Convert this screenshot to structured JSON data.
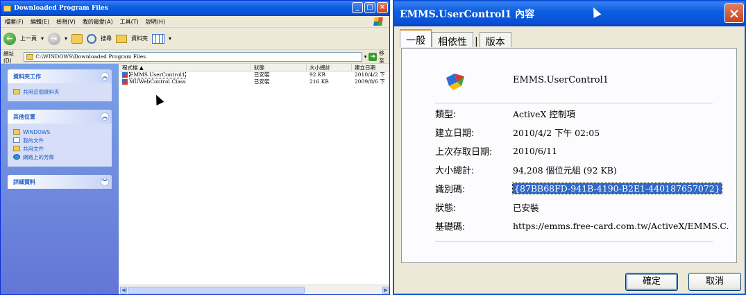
{
  "explorer": {
    "title": "Downloaded Program Files",
    "menu": [
      "檔案(F)",
      "編輯(E)",
      "檢視(V)",
      "我的最愛(A)",
      "工具(T)",
      "說明(H)"
    ],
    "toolbar": {
      "back": "上一頁",
      "search": "搜尋",
      "folders": "資料夾"
    },
    "address": {
      "label": "網址(D)",
      "path": "C:\\WINDOWS\\Downloaded Program Files",
      "go": "移至"
    },
    "taskpane": [
      {
        "title": "資料夾工作",
        "items": [
          {
            "label": "共用這個資料夾",
            "icon": "share-folder-icon"
          }
        ]
      },
      {
        "title": "其他位置",
        "items": [
          {
            "label": "WINDOWS",
            "icon": "folder-icon"
          },
          {
            "label": "我的文件",
            "icon": "documents-icon"
          },
          {
            "label": "共用文件",
            "icon": "folder-icon"
          },
          {
            "label": "網路上的芳鄰",
            "icon": "network-icon"
          }
        ]
      },
      {
        "title": "詳細資料",
        "items": []
      }
    ],
    "columns": [
      "程式檔",
      "狀態",
      "大小總計",
      "建立日期"
    ],
    "rows": [
      {
        "name": "EMMS.UserControl1",
        "status": "已安裝",
        "size": "92 KB",
        "date": "2010/4/2 下"
      },
      {
        "name": "MUWebControl Class",
        "status": "已安裝",
        "size": "216 KB",
        "date": "2009/8/6 下"
      }
    ]
  },
  "props": {
    "title": "EMMS.UserControl1 內容",
    "tabs": [
      "一般",
      "相依性",
      "版本"
    ],
    "control_name": "EMMS.UserControl1",
    "fields": [
      {
        "label": "類型:",
        "value": "ActiveX 控制項"
      },
      {
        "label": "建立日期:",
        "value": "2010/4/2 下午 02:05"
      },
      {
        "label": "上次存取日期:",
        "value": "2010/6/11"
      },
      {
        "label": "大小總計:",
        "value": "94,208 個位元組 (92 KB)"
      },
      {
        "label": "識別碼:",
        "value": "{87BB68FD-941B-4190-B2E1-440187657072}"
      },
      {
        "label": "狀態:",
        "value": "已安裝"
      },
      {
        "label": "基礎碼:",
        "value": "https://emms.free-card.com.tw/ActiveX/EMMS.C."
      }
    ],
    "ok_label": "確定",
    "cancel_label": "取消"
  }
}
